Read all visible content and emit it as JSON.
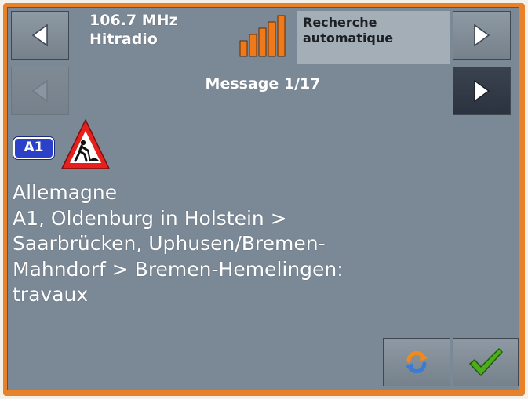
{
  "header": {
    "frequency": "106.7 MHz",
    "station_name": "Hitradio",
    "search_mode": [
      "Recherche",
      "automatique"
    ],
    "counter": "Message 1/17"
  },
  "icons": {
    "prev_station": "left-arrow-icon",
    "next_station": "right-arrow-icon",
    "prev_message": "left-arrow-icon",
    "next_message": "right-arrow-icon",
    "signal": "signal-strength-icon",
    "warning": "roadworks-warning-icon",
    "refresh": "refresh-icon",
    "confirm": "checkmark-icon"
  },
  "signal": {
    "bars_lit": 5,
    "bars_total": 5,
    "level": 1.0
  },
  "message": {
    "road": "A1",
    "lines": [
      "Allemagne",
      "A1, Oldenburg in Holstein >",
      "Saarbrücken, Uphusen/Bremen-",
      "Mahndorf > Bremen-Hemelingen:",
      "travaux"
    ]
  },
  "colors": {
    "frame": "#e7822a",
    "screen": "#7b8895",
    "signal_bar": "#f07a1a",
    "road_badge": "#2b42c8",
    "warning_red": "#e8201c",
    "check_green": "#4cae1a",
    "refresh_orange": "#f08a1e",
    "refresh_blue": "#3a7bd5"
  }
}
